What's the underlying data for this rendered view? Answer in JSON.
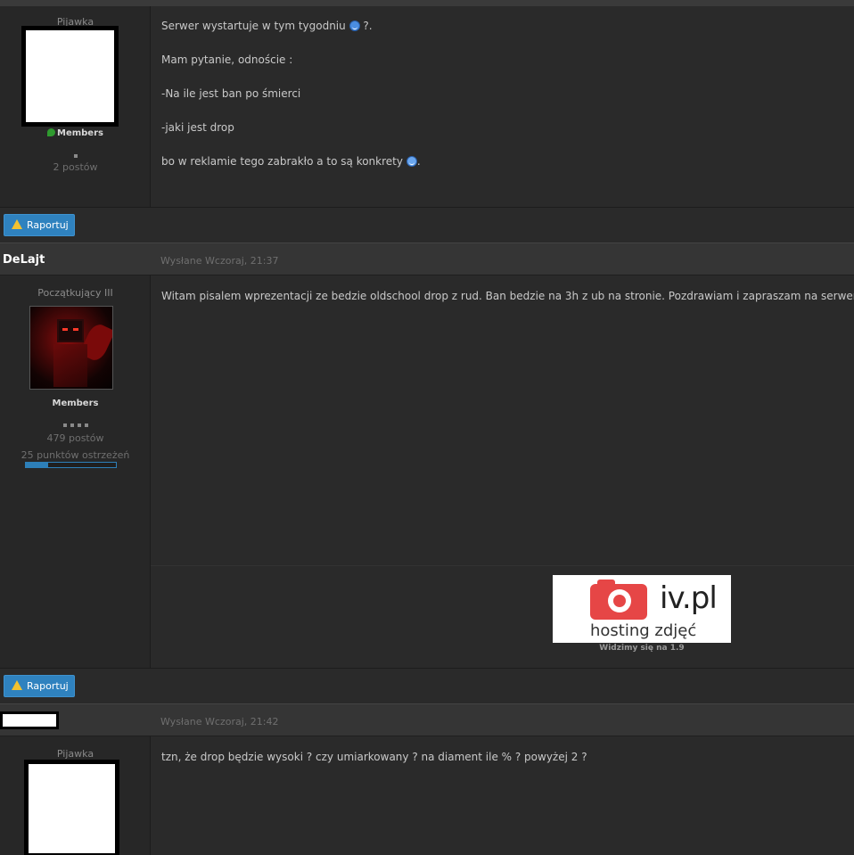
{
  "posts": [
    {
      "author_rank": "Pijawka",
      "group": "Members",
      "post_count": "2 postów",
      "lines": [
        "Serwer wystartuje w tym tygodniu",
        "?.",
        "Mam pytanie, odnoście :",
        "-Na ile jest ban po śmierci",
        "-jaki jest drop",
        "bo w reklamie tego zabrakło a to są konkrety",
        "."
      ],
      "report_label": "Raportuj"
    },
    {
      "author_name": "DeLajt",
      "date": "Wysłane Wczoraj, 21:37",
      "author_rank": "Początkujący III",
      "group": "Members",
      "post_count": "479 postów",
      "warnings": "25 punktów ostrzeżeń",
      "warning_level": 0.25,
      "text": "Witam pisalem wprezentacji ze bedzie oldschool drop z rud. Ban bedzie na 3h z ub na stronie. Pozdrawiam i zapraszam na serwer.",
      "signature": {
        "banner_iv": "iv.pl",
        "banner_host": "hosting zdjęć",
        "caption": "Widzimy się na 1.9"
      },
      "report_label": "Raportuj"
    },
    {
      "date": "Wysłane Wczoraj, 21:42",
      "author_rank": "Pijawka",
      "text": "tzn, że drop będzie wysoki ? czy umiarkowany ? na diament ile % ? powyżej 2 ?"
    }
  ],
  "colors": {
    "report_button": "#2f82bf",
    "warning_bar": "#2d7fb8",
    "group_icon": "#2f9a2f",
    "smiley": "#4a8de0"
  },
  "icons": [
    "warning-icon",
    "smile-icon",
    "laugh-icon",
    "group-icon",
    "camera-icon"
  ]
}
